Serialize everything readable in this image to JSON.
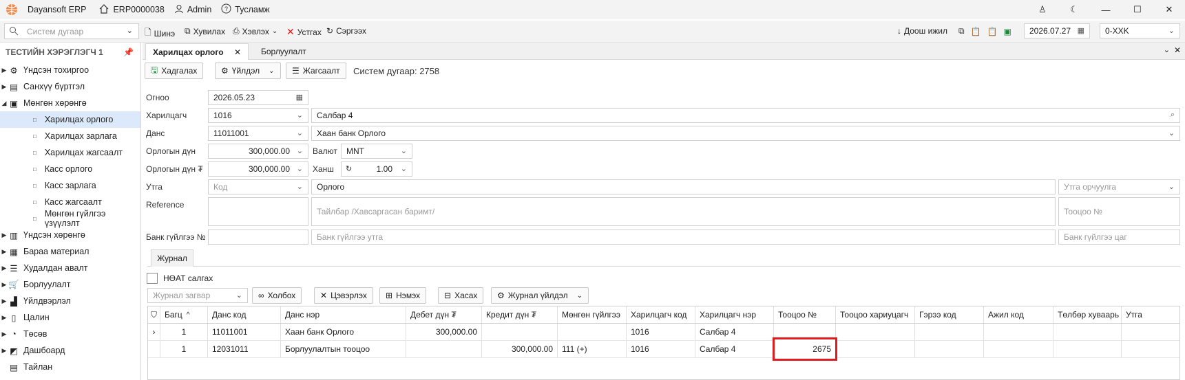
{
  "titlebar": {
    "app": "Dayansoft ERP",
    "company": "ERP0000038",
    "user": "Admin",
    "help": "Тусламж"
  },
  "toolbar": {
    "search_placeholder": "Систем дугаар",
    "new": "Шинэ",
    "copy": "Хувилах",
    "print": "Хэвлэх",
    "delete": "Устгах",
    "refresh": "Сэргээх",
    "download": "Доош ижил",
    "date": "2026.07.27",
    "branch": "0-XXK"
  },
  "sidebar": {
    "title": "ТЕСТИЙН ХЭРЭГЛЭГЧ 1",
    "items": [
      {
        "label": "Үндсэн тохиргоо"
      },
      {
        "label": "Санхүү бүртгэл"
      },
      {
        "label": "Мөнгөн хөрөнгө"
      },
      {
        "label": "Харилцах орлого"
      },
      {
        "label": "Харилцах зарлага"
      },
      {
        "label": "Харилцах жагсаалт"
      },
      {
        "label": "Касс орлого"
      },
      {
        "label": "Касс зарлага"
      },
      {
        "label": "Касс жагсаалт"
      },
      {
        "label": "Мөнгөн гүйлгээ үзүүлэлт"
      },
      {
        "label": "Үндсэн хөрөнгө"
      },
      {
        "label": "Бараа материал"
      },
      {
        "label": "Худалдан авалт"
      },
      {
        "label": "Борлуулалт"
      },
      {
        "label": "Үйлдвэрлэл"
      },
      {
        "label": "Цалин"
      },
      {
        "label": "Төсөв"
      },
      {
        "label": "Дашбоард"
      },
      {
        "label": "Тайлан"
      }
    ]
  },
  "tabs": {
    "active": "Харилцах орлого",
    "second": "Борлуулалт"
  },
  "actions": {
    "save": "Хадгалах",
    "operation": "Үйлдэл",
    "list": "Жагсаалт",
    "sysno": "Систем дугаар: 2758"
  },
  "form": {
    "date_label": "Огноо",
    "date": "2026.05.23",
    "customer_label": "Харилцагч",
    "customer_code": "1016",
    "customer_name": "Салбар 4",
    "account_label": "Данс",
    "account_code": "11011001",
    "account_name": "Хаан банк Орлого",
    "amount_label": "Орлогын дүн",
    "amount": "300,000.00",
    "amount_mnt_label": "Орлогын дүн ₮",
    "amount_mnt": "300,000.00",
    "currency_label": "Валют",
    "currency": "MNT",
    "rate_label": "Ханш",
    "rate": "1.00",
    "purpose_label": "Утга",
    "code_placeholder": "Код",
    "purpose": "Орлого",
    "translate_placeholder": "Утга орчуулга",
    "reference_label": "Reference",
    "desc_placeholder": "Тайлбар /Хавсаргасан баримт/",
    "settle_placeholder": "Тооцоо №",
    "bank_label": "Банк гүйлгээ №",
    "bank_purpose_placeholder": "Банк гүйлгээ утга",
    "bank_time_placeholder": "Банк гүйлгээ цаг"
  },
  "journal": {
    "tab": "Журнал",
    "vat": "НӨАТ салгах",
    "template_placeholder": "Журнал загвар",
    "link": "Холбох",
    "clear": "Цэвэрлэх",
    "add": "Нэмэх",
    "remove": "Хасах",
    "ops": "Журнал үйлдэл",
    "columns": [
      "Багц",
      "Данс код",
      "Данс нэр",
      "Дебет дүн ₮",
      "Кредит дүн ₮",
      "Мөнгөн гүйлгээ",
      "Харилцагч код",
      "Харилцагч нэр",
      "Тооцоо №",
      "Тооцоо хариуцагч",
      "Гэрээ код",
      "Ажил код",
      "Төлбөр хуваарь",
      "Утга"
    ],
    "rows": [
      [
        "1",
        "11011001",
        "Хаан банк Орлого",
        "300,000.00",
        "",
        "",
        "1016",
        "Салбар 4",
        "",
        "",
        "",
        "",
        "",
        ""
      ],
      [
        "1",
        "12031011",
        "Борлуулалтын тооцоо",
        "",
        "300,000.00",
        "111 (+)",
        "1016",
        "Салбар 4",
        "2675",
        "",
        "",
        "",
        "",
        ""
      ]
    ]
  },
  "colors": {
    "highlight": "#e01b1b",
    "selection": "#dbe9fb",
    "accent": "#e8632a"
  }
}
